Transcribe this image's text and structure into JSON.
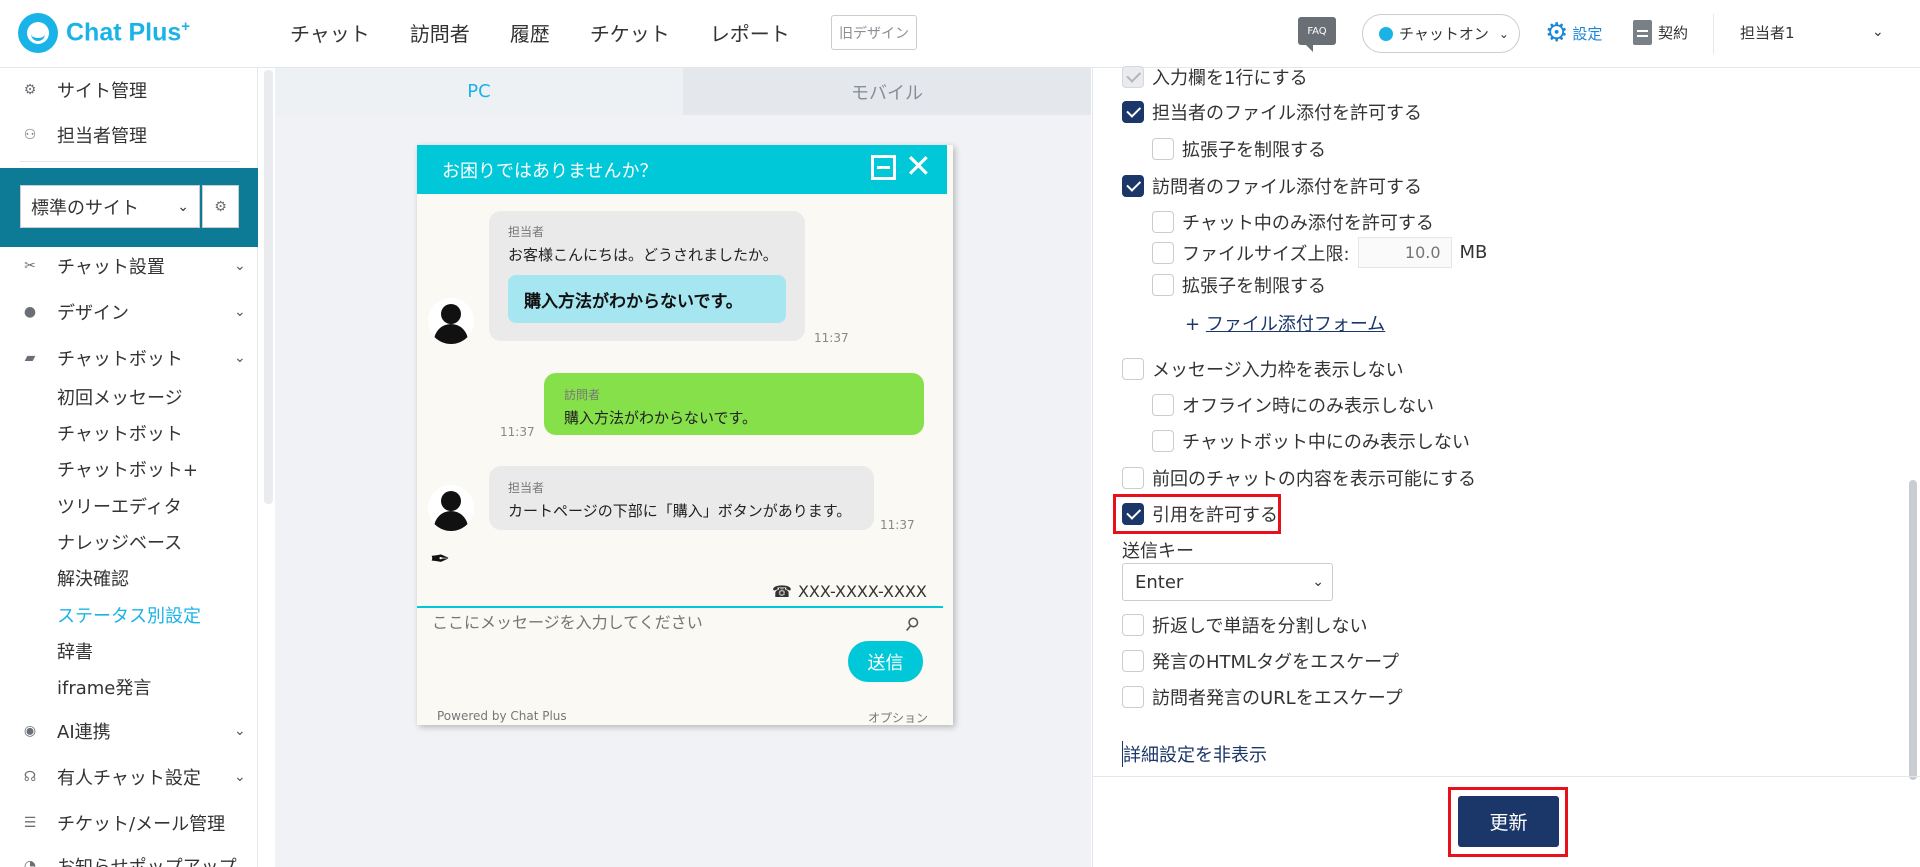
{
  "app": {
    "logo_text": "Chat Plus",
    "logo_sup": "+"
  },
  "topnav": {
    "items": [
      "チャット",
      "訪問者",
      "履歴",
      "チケット",
      "レポート"
    ],
    "old_design": "旧デザイン",
    "faq": "FAQ",
    "chat_status": "チャットオン",
    "settings": "設定",
    "contract": "契約",
    "user": "担当者1"
  },
  "sidebar": {
    "top_items": [
      "サイト管理",
      "担当者管理"
    ],
    "site_select": "標準のサイト",
    "sections": [
      {
        "label": "チャット設置"
      },
      {
        "label": "デザイン"
      },
      {
        "label": "チャットボット"
      }
    ],
    "chatbot_sub": [
      "初回メッセージ",
      "チャットボット",
      "チャットボット+",
      "ツリーエディタ",
      "ナレッジベース",
      "解決確認",
      "ステータス別設定",
      "辞書",
      "iframe発言"
    ],
    "active_sub": "ステータス別設定",
    "lower_sections": [
      {
        "label": "AI連携"
      },
      {
        "label": "有人チャット設定"
      },
      {
        "label": "チケット/メール管理"
      },
      {
        "label": "お知らせポップアップ"
      }
    ]
  },
  "preview": {
    "tabs": [
      "PC",
      "モバイル"
    ],
    "active_tab": "PC",
    "widget_title": "お困りではありませんか？",
    "messages": [
      {
        "role": "operator",
        "name": "担当者",
        "text": "お客様こんにちは。どうされましたか。",
        "quick_reply": "購入方法がわからないです。",
        "time": "11:37"
      },
      {
        "role": "visitor",
        "name": "訪問者",
        "text": "購入方法がわからないです。",
        "time": "11:37"
      },
      {
        "role": "operator",
        "name": "担当者",
        "text": "カートページの下部に「購入」ボタンがあります。",
        "time": "11:37"
      }
    ],
    "phone": "XXX-XXXX-XXXX",
    "input_placeholder": "ここにメッセージを入力してください",
    "send_label": "送信",
    "powered_by": "Powered by Chat Plus",
    "option": "オプション"
  },
  "settings": {
    "single_line_input": {
      "label": "入力欄を1行にする",
      "checked": true,
      "disabled": true
    },
    "operator_file_attach": {
      "label": "担当者のファイル添付を許可する",
      "checked": true
    },
    "operator_ext_limit": {
      "label": "拡張子を制限する",
      "checked": false
    },
    "visitor_file_attach": {
      "label": "訪問者のファイル添付を許可する",
      "checked": true
    },
    "visitor_only_in_chat": {
      "label": "チャット中のみ添付を許可する",
      "checked": false
    },
    "file_size_limit": {
      "label": "ファイルサイズ上限:",
      "placeholder": "10.0",
      "unit": "MB",
      "checked": false
    },
    "visitor_ext_limit": {
      "label": "拡張子を制限する",
      "checked": false
    },
    "add_form_link": {
      "prefix": "+",
      "label": "ファイル添付フォーム"
    },
    "hide_message_input": {
      "label": "メッセージ入力枠を表示しない",
      "checked": false
    },
    "hide_offline_only": {
      "label": "オフライン時にのみ表示しない",
      "checked": false
    },
    "hide_chatbot_only": {
      "label": "チャットボット中にのみ表示しない",
      "checked": false
    },
    "show_previous_chat": {
      "label": "前回のチャットの内容を表示可能にする",
      "checked": false
    },
    "allow_quote": {
      "label": "引用を許可する",
      "checked": true
    },
    "send_key": {
      "label": "送信キー",
      "value": "Enter"
    },
    "no_word_break": {
      "label": "折返しで単語を分割しない",
      "checked": false
    },
    "escape_html": {
      "label": "発言のHTMLタグをエスケープ",
      "checked": false
    },
    "escape_visitor_url": {
      "label": "訪問者発言のURLをエスケープ",
      "checked": false
    },
    "advanced_toggle": "詳細設定を非表示",
    "update_button": "更新"
  },
  "colors": {
    "accent": "#1ab3e8",
    "primary_button": "#1b3668",
    "widget_header": "#00c8d8",
    "highlight": "#e8101a",
    "visitor_bubble": "#86e04a"
  }
}
